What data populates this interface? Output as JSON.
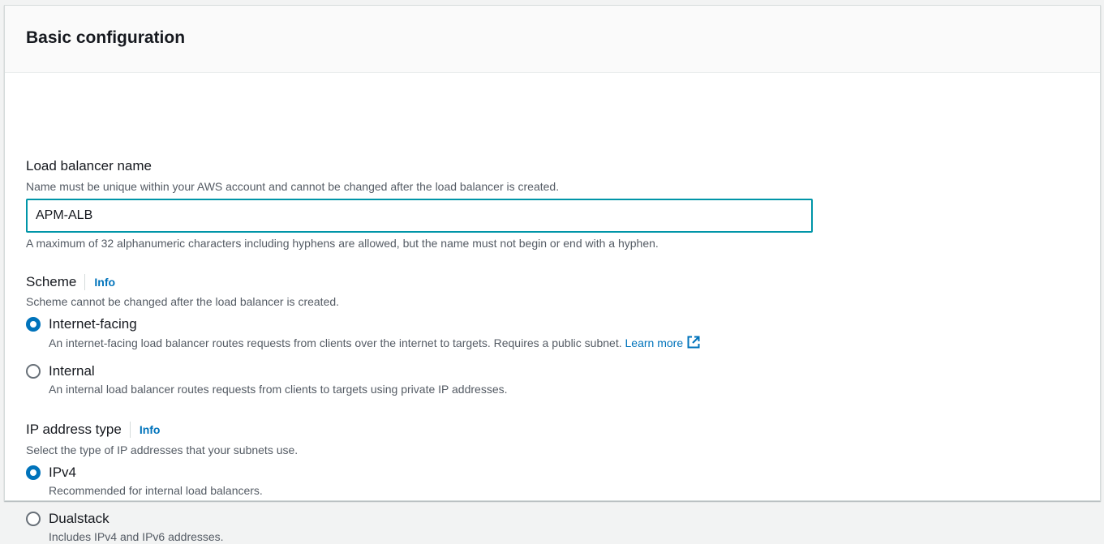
{
  "panel": {
    "title": "Basic configuration"
  },
  "name_field": {
    "label": "Load balancer name",
    "description": "Name must be unique within your AWS account and cannot be changed after the load balancer is created.",
    "value": "APM-ALB",
    "constraint": "A maximum of 32 alphanumeric characters including hyphens are allowed, but the name must not begin or end with a hyphen."
  },
  "scheme": {
    "label": "Scheme",
    "info_label": "Info",
    "description": "Scheme cannot be changed after the load balancer is created.",
    "options": [
      {
        "label": "Internet-facing",
        "description": "An internet-facing load balancer routes requests from clients over the internet to targets. Requires a public subnet.",
        "link": "Learn more",
        "checked": true
      },
      {
        "label": "Internal",
        "description": "An internal load balancer routes requests from clients to targets using private IP addresses.",
        "checked": false
      }
    ]
  },
  "ip_type": {
    "label": "IP address type",
    "info_label": "Info",
    "description": "Select the type of IP addresses that your subnets use.",
    "options": [
      {
        "label": "IPv4",
        "description": "Recommended for internal load balancers.",
        "checked": true
      },
      {
        "label": "Dualstack",
        "description": "Includes IPv4 and IPv6 addresses.",
        "checked": false
      }
    ]
  },
  "colors": {
    "accent": "#0073bb",
    "focus_border": "#0095a8",
    "text_primary": "#16191f",
    "text_secondary": "#545b64"
  },
  "icons": {
    "external_link": "external-link-icon"
  }
}
